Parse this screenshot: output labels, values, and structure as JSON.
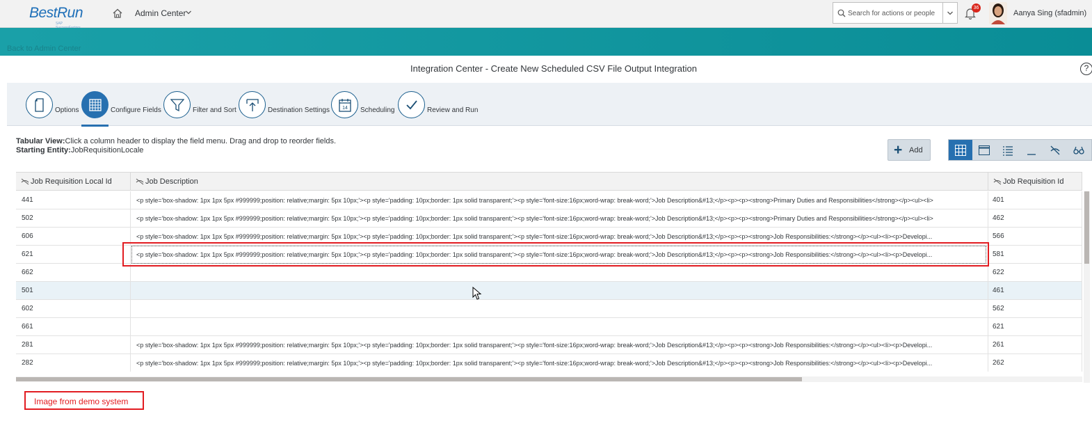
{
  "shell": {
    "logo_text": "BestRun",
    "logo_sub": "SAP SuccessFactors",
    "title": "Admin Center",
    "search_placeholder": "Search for actions or people",
    "notification_count": "36",
    "user_name": "Aanya Sing (sfadmin)"
  },
  "nav": {
    "back_link": "Back to Admin Center"
  },
  "page": {
    "title": "Integration Center - Create New Scheduled CSV File Output Integration",
    "help": "?"
  },
  "steps": [
    {
      "label": "Options",
      "icon": "document-icon"
    },
    {
      "label": "Configure Fields",
      "icon": "grid-icon",
      "active": true
    },
    {
      "label": "Filter and Sort",
      "icon": "filter-icon"
    },
    {
      "label": "Destination Settings",
      "icon": "upload-icon"
    },
    {
      "label": "Scheduling",
      "icon": "calendar-icon"
    },
    {
      "label": "Review and Run",
      "icon": "check-icon"
    }
  ],
  "info": {
    "view_label": "Tabular View:",
    "view_text": "Click a column header to display the field menu. Drag and drop to reorder fields.",
    "entity_label": "Starting Entity:",
    "entity_value": "JobRequisitionLocale"
  },
  "toolbar": {
    "add_label": "Add"
  },
  "table": {
    "columns": [
      "Job Requisition Local Id",
      "Job Description",
      "Job Requisition Id"
    ],
    "rows": [
      [
        "441",
        "<p style='box-shadow: 1px 1px 5px #999999;position: relative;margin: 5px 10px;'><p style='padding: 10px;border: 1px solid transparent;'><p style='font-size:16px;word-wrap: break-word;'>Job Description&#13;</p><p><p><strong>Primary Duties and Responsibilities</strong></p><ul><li>",
        "401"
      ],
      [
        "502",
        "<p style='box-shadow: 1px 1px 5px #999999;position: relative;margin: 5px 10px;'><p style='padding: 10px;border: 1px solid transparent;'><p style='font-size:16px;word-wrap: break-word;'>Job Description&#13;</p><p><p><strong>Primary Duties and Responsibilities</strong></p><ul><li>",
        "462"
      ],
      [
        "606",
        "<p style='box-shadow: 1px 1px 5px #999999;position: relative;margin: 5px 10px;'><p style='padding: 10px;border: 1px solid transparent;'><p style='font-size:16px;word-wrap: break-word;'>Job Description&#13;</p><p><p><strong>Job Responsibilities:</strong></p><ul><li><p>Developi...",
        "566"
      ],
      [
        "621",
        "<p style='box-shadow: 1px 1px 5px #999999;position: relative;margin: 5px 10px;'><p style='padding: 10px;border: 1px solid transparent;'><p style='font-size:16px;word-wrap: break-word;'>Job Description&#13;</p><p><p><strong>Job Responsibilities:</strong></p><ul><li><p>Developi...",
        "581"
      ],
      [
        "662",
        "",
        "622"
      ],
      [
        "501",
        "",
        "461"
      ],
      [
        "602",
        "",
        "562"
      ],
      [
        "661",
        "",
        "621"
      ],
      [
        "281",
        "<p style='box-shadow: 1px 1px 5px #999999;position: relative;margin: 5px 10px;'><p style='padding: 10px;border: 1px solid transparent;'><p style='font-size:16px;word-wrap: break-word;'>Job Description&#13;</p><p><p><strong>Job Responsibilities:</strong></p><ul><li><p>Developi...",
        "261"
      ],
      [
        "282",
        "<p style='box-shadow: 1px 1px 5px #999999;position: relative;margin: 5px 10px;'><p style='padding: 10px;border: 1px solid transparent;'><p style='font-size:16px;word-wrap: break-word;'>Job Description&#13;</p><p><p><strong>Job Responsibilities:</strong></p><ul><li><p>Developi...",
        "262"
      ]
    ]
  },
  "annotation": {
    "text": "Image from demo system"
  },
  "colors": {
    "accent": "#2770b0",
    "band": "#0a8d96",
    "highlight": "#e21c21"
  }
}
